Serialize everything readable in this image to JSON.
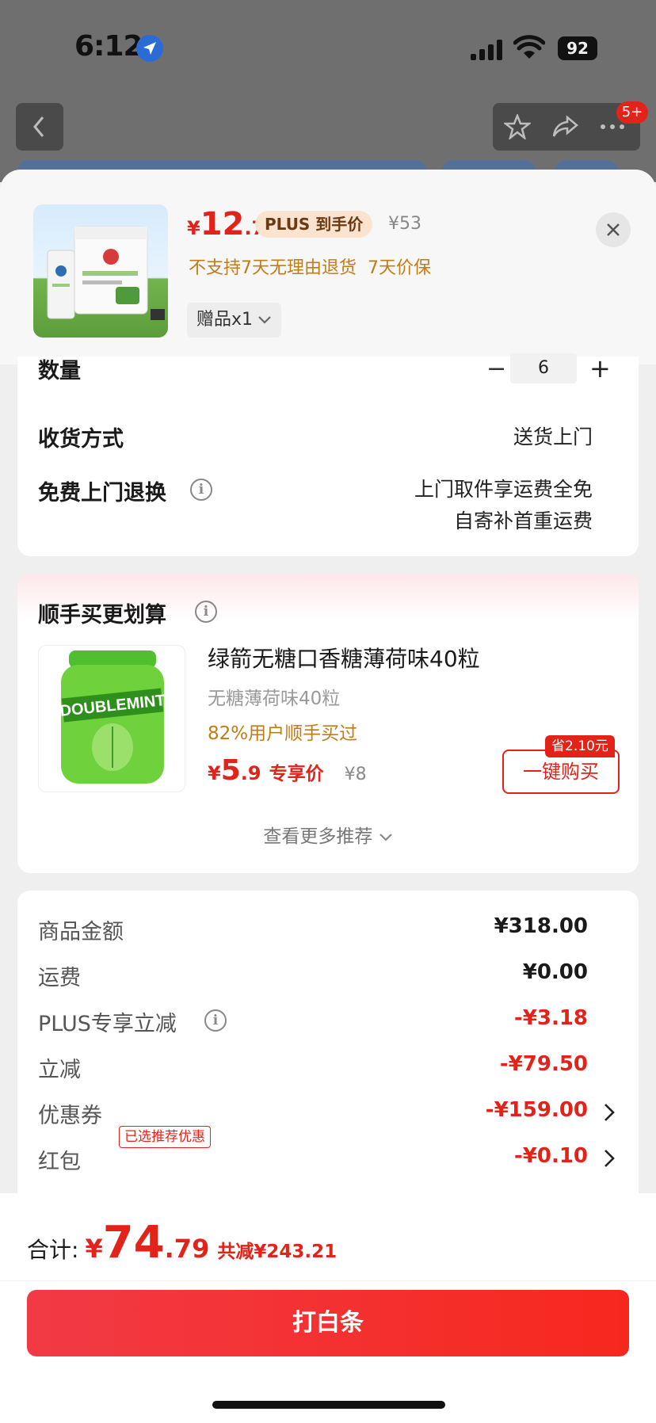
{
  "status_bar": {
    "time": "6:12",
    "battery": "92"
  },
  "nav": {
    "message_badge": "5+"
  },
  "product": {
    "currency": "¥",
    "price_int": "12",
    "price_dec": ".7",
    "plus_tag": "PLUS 到手价",
    "orig_price": "¥53",
    "notice": "不支持7天无理由退货  7天价保",
    "gift": "赠品x1"
  },
  "options": {
    "quantity_label": "数量",
    "quantity_value": "6",
    "delivery_label": "收货方式",
    "delivery_value": "送货上门",
    "return_label": "免费上门退换",
    "return_line1": "上门取件享运费全免",
    "return_line2": "自寄补首重运费"
  },
  "recommend": {
    "title": "顺手买更划算",
    "item_title": "绿箭无糖口香糖薄荷味40粒",
    "item_sub": "无糖薄荷味40粒",
    "item_pct": "82%用户顺手买过",
    "currency": "¥",
    "price_int": "5",
    "price_dec": ".9",
    "exclusive": "专享价",
    "orig_price": "¥8",
    "save_badge": "省2.10元",
    "buy_label": "一键购买",
    "more": "查看更多推荐"
  },
  "summary": {
    "rows": [
      {
        "label": "商品金额",
        "value": "¥318.00"
      },
      {
        "label": "运费",
        "value": "¥0.00"
      },
      {
        "label": "PLUS专享立减",
        "value": "-¥3.18"
      },
      {
        "label": "立减",
        "value": "-¥79.50"
      },
      {
        "label": "优惠券",
        "value": "-¥159.00",
        "tag": "已选推荐优惠"
      },
      {
        "label": "红包",
        "value": "-¥0.10"
      }
    ]
  },
  "footer": {
    "total_label": "合计:",
    "currency": "¥",
    "total_int": "74",
    "total_dec": ".79",
    "total_save": "共减¥243.21",
    "pay_label": "打白条"
  },
  "colors": {
    "accent": "#e2231a",
    "orange": "#c27c17",
    "plus_bg": "#fbe3cf"
  },
  "icons": [
    "location-arrow-icon",
    "signal-icon",
    "wifi-icon",
    "back-icon",
    "star-icon",
    "share-icon",
    "more-icon",
    "close-icon",
    "chevron-down-icon",
    "info-icon",
    "chevron-right-icon"
  ]
}
